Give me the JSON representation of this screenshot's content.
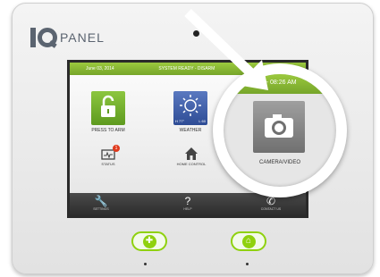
{
  "brand": {
    "logo_text": "PANEL"
  },
  "status_bar": {
    "date": "June 03, 2014",
    "system_status": "SYSTEM READY - DISARM",
    "time": "Tue - 08:26 AM"
  },
  "tiles": {
    "arm": {
      "label": "PRESS TO ARM"
    },
    "weather": {
      "label": "WEATHER",
      "temp": "H 77°",
      "low": "L 60"
    },
    "camera": {
      "label": "CAMERA/VIDEO"
    }
  },
  "small_icons": {
    "status": {
      "label": "STATUS",
      "badge": "1"
    },
    "home_control": {
      "label": "HOME CONTROL"
    }
  },
  "bottom_bar": {
    "settings": "SETTINGS",
    "help": "HELP",
    "contact": "CONTACT US"
  },
  "colors": {
    "accent_green": "#8fd10e",
    "status_green": "#76a52a",
    "arm_tile": "#5e9a1f",
    "weather_tile": "#2e4c95",
    "camera_tile": "#707070"
  },
  "icons": [
    "lock-open-icon",
    "sun-icon",
    "camera-icon",
    "status-icon",
    "house-icon",
    "wrench-icon",
    "question-icon",
    "phone-icon",
    "arrow-icon",
    "emergency-icon",
    "home-icon"
  ]
}
